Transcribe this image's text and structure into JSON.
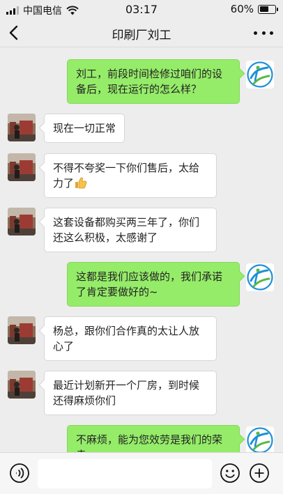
{
  "status_bar": {
    "carrier": "中国电信",
    "time": "03:17",
    "battery_percent": "60%",
    "battery_level": 0.6
  },
  "nav": {
    "title": "印刷厂刘工",
    "back_icon": "chevron-left-icon",
    "more_icon": "more-dots-icon"
  },
  "messages": [
    {
      "side": "right",
      "text": "刘工，前段时间检修过咱们的设备后，现在运行的怎么样？"
    },
    {
      "side": "left",
      "text": "现在一切正常"
    },
    {
      "side": "left",
      "text": "不得不夸奖一下你们售后，太给力了",
      "emoji": "thumbs-up-icon"
    },
    {
      "side": "left",
      "text": "这套设备都购买两三年了，你们还这么积极，太感谢了"
    },
    {
      "side": "right",
      "text": "这都是我们应该做的，我们承诺了肯定要做好的~"
    },
    {
      "side": "left",
      "text": "杨总，跟你们合作真的太让人放心了"
    },
    {
      "side": "left",
      "text": "最近计划新开一个厂房，到时候还得麻烦你们"
    },
    {
      "side": "right",
      "text": "不麻烦，能为您效劳是我们的荣幸"
    }
  ],
  "input_bar": {
    "voice_icon": "voice-icon",
    "emoji_icon": "emoji-icon",
    "plus_icon": "plus-icon",
    "placeholder": ""
  },
  "colors": {
    "background": "#ededed",
    "bubble_self": "#95ec69",
    "bubble_other": "#ffffff"
  }
}
